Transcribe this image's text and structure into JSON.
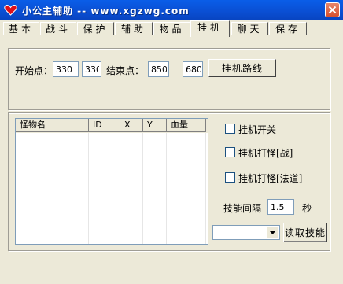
{
  "window": {
    "title": "小公主辅助 -- www.xgzwg.com"
  },
  "tabs": [
    "基本",
    "战斗",
    "保护",
    "辅助",
    "物品",
    "挂机",
    "聊天",
    "保存"
  ],
  "active_tab": "挂机",
  "route": {
    "start_label": "开始点：",
    "start_x": "330",
    "start_y": "330",
    "end_label": "结束点：",
    "end_x": "850",
    "end_y": "680",
    "route_button": "挂机路线"
  },
  "monster_list": {
    "columns": [
      "怪物名",
      "ID",
      "X",
      "Y",
      "血量"
    ],
    "rows": []
  },
  "options": {
    "afk_toggle": "挂机开关",
    "afk_fight_warrior": "挂机打怪[战]",
    "afk_fight_taoist": "挂机打怪[法道]"
  },
  "skill": {
    "interval_label": "技能间隔",
    "interval_value": "1.5",
    "interval_unit": "秒",
    "selected_skill": "",
    "read_button": "读取技能"
  },
  "colors": {
    "titlebar": "#0a5ee8",
    "window_bg": "#ece9d8",
    "close_button": "#d9502d"
  }
}
